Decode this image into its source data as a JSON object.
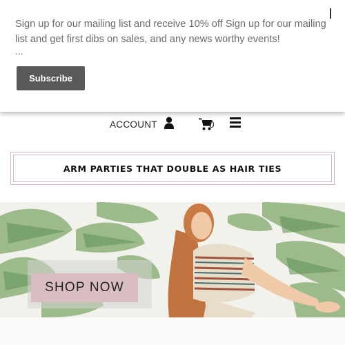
{
  "popup": {
    "message": "Sign up for our mailing list and receive 10% off Sign up for our mailing list and get first dibs on sales, and any news worthy events!",
    "ellipsis": "...",
    "subscribe_label": "Subscribe"
  },
  "nav": {
    "account_label": "ACCOUNT",
    "cart_count": "0",
    "icons": [
      "user-icon",
      "cart-icon",
      "menu-icon"
    ]
  },
  "promo": {
    "text": "ARM PARTIES THAT DOUBLE AS HAIR TIES",
    "border_color": "#d6b6be"
  },
  "hero": {
    "cta_label": "SHOP NOW",
    "cta_color": "#d9bdc1"
  }
}
